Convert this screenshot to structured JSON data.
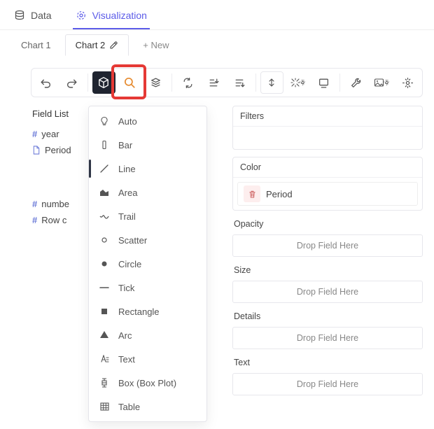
{
  "top_tabs": {
    "data": "Data",
    "viz": "Visualization"
  },
  "chart_tabs": {
    "chart1": "Chart 1",
    "chart2": "Chart 2",
    "new": "+ New"
  },
  "fields": {
    "title": "Field List",
    "year": "year",
    "period": "Period",
    "number": "numbe",
    "rowc": "Row c"
  },
  "dropdown": {
    "auto": "Auto",
    "bar": "Bar",
    "line": "Line",
    "area": "Area",
    "trail": "Trail",
    "scatter": "Scatter",
    "circle": "Circle",
    "tick": "Tick",
    "rectangle": "Rectangle",
    "arc": "Arc",
    "text": "Text",
    "box": "Box (Box Plot)",
    "table": "Table"
  },
  "panel": {
    "filters": "Filters",
    "color": "Color",
    "period_pill": "Period",
    "opacity": "Opacity",
    "size": "Size",
    "details": "Details",
    "text": "Text",
    "drop": "Drop Field Here"
  }
}
